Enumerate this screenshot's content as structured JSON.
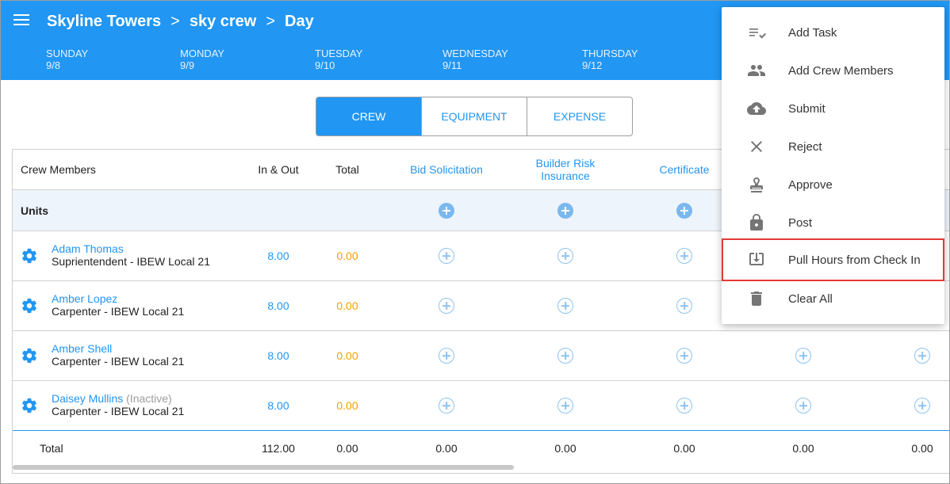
{
  "header": {
    "breadcrumb": [
      "Skyline Towers",
      "sky crew",
      "Day"
    ],
    "days": [
      {
        "name": "SUNDAY",
        "date": "9/8"
      },
      {
        "name": "MONDAY",
        "date": "9/9"
      },
      {
        "name": "TUESDAY",
        "date": "9/10"
      },
      {
        "name": "WEDNESDAY",
        "date": "9/11"
      },
      {
        "name": "THURSDAY",
        "date": "9/12"
      }
    ]
  },
  "tabs": [
    "CREW",
    "EQUIPMENT",
    "EXPENSE"
  ],
  "table": {
    "headers": {
      "crew_members": "Crew Members",
      "in_out": "In & Out",
      "total": "Total",
      "bid": "Bid Solicitation",
      "builder_line1": "Builder Risk",
      "builder_line2": "Insurance",
      "certificate": "Certificate"
    },
    "units_label": "Units",
    "rows": [
      {
        "name": "Adam Thomas",
        "status": "",
        "role": "Suprientendent - IBEW Local 21",
        "in_out": "8.00",
        "total": "0.00"
      },
      {
        "name": "Amber Lopez",
        "status": "",
        "role": "Carpenter - IBEW Local 21",
        "in_out": "8.00",
        "total": "0.00"
      },
      {
        "name": "Amber Shell",
        "status": "",
        "role": "Carpenter - IBEW Local 21",
        "in_out": "8.00",
        "total": "0.00"
      },
      {
        "name": "Daisey Mullins",
        "status": "(Inactive)",
        "role": "Carpenter - IBEW Local 21",
        "in_out": "8.00",
        "total": "0.00"
      }
    ],
    "totals": {
      "label": "Total",
      "values": [
        "112.00",
        "0.00",
        "0.00",
        "0.00",
        "0.00",
        "0.00",
        "0.00"
      ]
    }
  },
  "menu": {
    "items": [
      {
        "label": "Add Task",
        "icon": "task-list-icon"
      },
      {
        "label": "Add Crew Members",
        "icon": "people-icon"
      },
      {
        "label": "Submit",
        "icon": "cloud-upload-icon"
      },
      {
        "label": "Reject",
        "icon": "close-icon"
      },
      {
        "label": "Approve",
        "icon": "stamp-icon"
      },
      {
        "label": "Post",
        "icon": "lock-icon"
      },
      {
        "label": "Pull Hours from Check In",
        "icon": "download-box-icon"
      },
      {
        "label": "Clear All",
        "icon": "trash-icon"
      }
    ]
  },
  "colors": {
    "primary": "#2196f3",
    "orange": "#f59f00",
    "highlight": "#e53935"
  }
}
